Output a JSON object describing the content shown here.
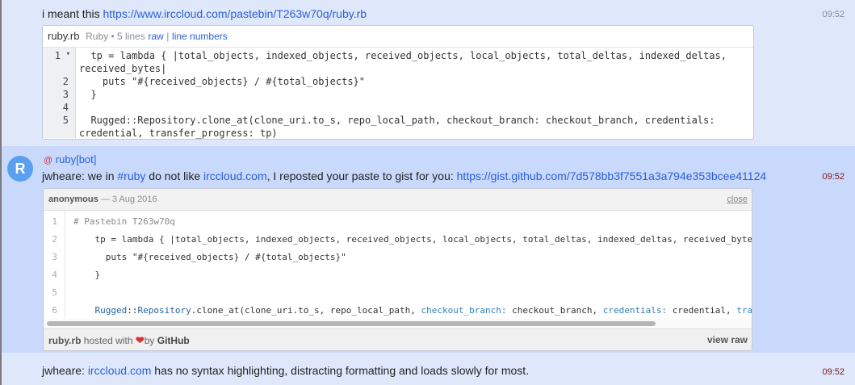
{
  "messages": [
    {
      "text_before": "i meant this ",
      "link": "https://www.irccloud.com/pastebin/T263w70q/ruby.rb",
      "time": "09:52"
    },
    {
      "author": "ruby[bot]",
      "avatar_letter": "R",
      "parts": [
        "jwheare: we in ",
        "#ruby",
        " do not like ",
        "irccloud.com",
        ", I reposted your paste to gist for you: ",
        "https://gist.github.com/7d578bb3f7551a3a794e353bcee41124"
      ],
      "time": "09:52"
    },
    {
      "parts": [
        "jwheare: ",
        "irccloud.com",
        " has no syntax highlighting, distracting formatting and loads slowly for most."
      ],
      "time": "09:52"
    }
  ],
  "paste": {
    "filename": "ruby.rb",
    "meta": "Ruby • 5 lines",
    "raw_link": "raw",
    "separator": "|",
    "line_numbers_link": "line numbers",
    "line_numbers": [
      "1",
      "2",
      "3",
      "4",
      "5"
    ],
    "fold_marker": "▾",
    "lines": [
      "  tp = lambda { |total_objects, indexed_objects, received_objects, local_objects, total_deltas, indexed_deltas,",
      "received_bytes|",
      "    puts \"#{received_objects} / #{total_objects}\"",
      "  }",
      "",
      "  Rugged::Repository.clone_at(clone_uri.to_s, repo_local_path, checkout_branch: checkout_branch, credentials:",
      "credential, transfer_progress: tp)"
    ]
  },
  "gist": {
    "author": "anonymous",
    "date": " — 3 Aug 2016",
    "close_label": "close",
    "line_numbers": [
      "1",
      "2",
      "3",
      "4",
      "5",
      "6"
    ],
    "line1": "# Pastebin T263w70q",
    "line2": "    tp = lambda { |total_objects, indexed_objects, received_objects, local_objects, total_deltas, indexed_deltas, received_byte",
    "line3": "      puts \"#{received_objects} / #{total_objects}\"",
    "line4": "    }",
    "line6_indent": "    ",
    "line6_class": "Rugged",
    "line6_ns": "::",
    "line6_class2": "Repository",
    "line6_a": ".clone_at(clone_uri.to_s, repo_local_path, ",
    "line6_sym1": "checkout_branch:",
    "line6_b": " checkout_branch, ",
    "line6_sym2": "credentials:",
    "line6_c": " credential, ",
    "line6_sym3": "tra",
    "footer_filename": "ruby.rb",
    "footer_hosted": " hosted with ",
    "footer_heart": "❤",
    "footer_by": "by ",
    "footer_github": "GitHub",
    "view_raw": "view raw"
  },
  "colors": {
    "link": "#2a5fd8",
    "highlight_row": "#c9d9fb",
    "row": "#dfe8fb",
    "avatar": "#5aa0ef"
  }
}
